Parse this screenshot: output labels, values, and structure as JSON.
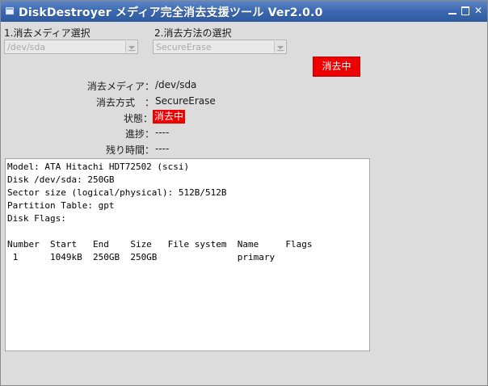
{
  "window": {
    "title": "DiskDestroyer メディア完全消去支援ツール Ver2.0.0"
  },
  "step1": {
    "label": "1.消去メディア選択",
    "selected": "/dev/sda"
  },
  "step2": {
    "label": "2.消去方法の選択",
    "selected": "SecureErase"
  },
  "action_button": {
    "label": "消去中",
    "color": "#ee0000"
  },
  "info": {
    "media_key": "消去メディア：",
    "media_val": "/dev/sda",
    "method_key": "消去方式　：",
    "method_val": "SecureErase",
    "status_key": "状態：",
    "status_val": "消去中",
    "progress_key": "進捗：",
    "progress_val": "----",
    "remaining_key": "残り時間：",
    "remaining_val": "----"
  },
  "output": {
    "lines": [
      "Model: ATA Hitachi HDT72502 (scsi)",
      "Disk /dev/sda: 250GB",
      "Sector size (logical/physical): 512B/512B",
      "Partition Table: gpt",
      "Disk Flags:",
      "",
      "Number  Start   End    Size   File system  Name     Flags",
      " 1      1049kB  250GB  250GB               primary"
    ]
  },
  "icons": {
    "app": "window-app-icon",
    "minimize": "minimize-icon",
    "maximize": "maximize-icon",
    "close": "close-icon"
  }
}
